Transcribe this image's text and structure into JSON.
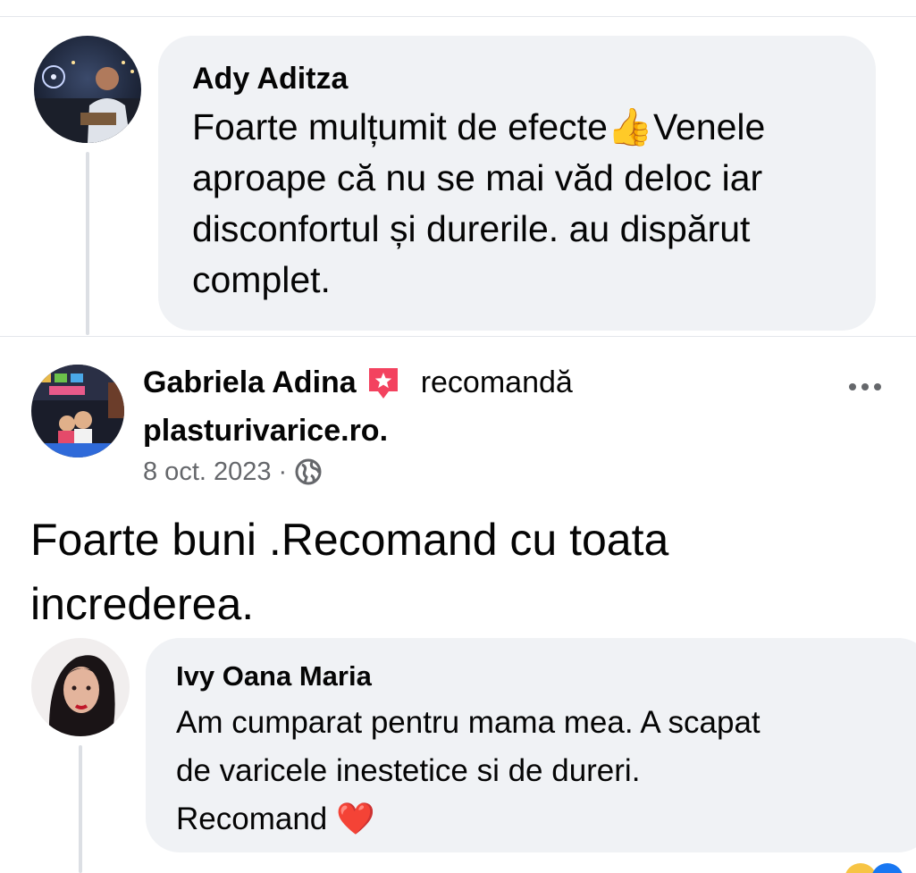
{
  "comment1": {
    "author": "Ady Aditza",
    "text_before_emoji": "Foarte mulțumit de efecte",
    "emoji": "👍",
    "text_after_emoji": "Venele",
    "line2": "aproape că nu se mai văd deloc iar",
    "line3": "disconfortul și durerile. au dispărut",
    "line4": "complet."
  },
  "post": {
    "author": "Gabriela Adina",
    "recommend_word": "recomandă",
    "page": "plasturivarice.ro.",
    "date": "8 oct. 2023",
    "separator": "·",
    "visibility_icon": "globe-icon",
    "body_line1": "Foarte buni .Recomand cu toata",
    "body_line2": "increderea.",
    "menu_icon": "more-horizontal-icon"
  },
  "comment2": {
    "author": "Ivy Oana Maria",
    "line1": "Am cumparat pentru mama mea. A scapat",
    "line2": "de varicele inestetice si de dureri.",
    "line3_text": "Recomand",
    "line3_emoji": "❤️"
  },
  "colors": {
    "bubble": "#f0f2f5",
    "secondary_text": "#65676b",
    "recommend_badge": "#f3425f"
  }
}
